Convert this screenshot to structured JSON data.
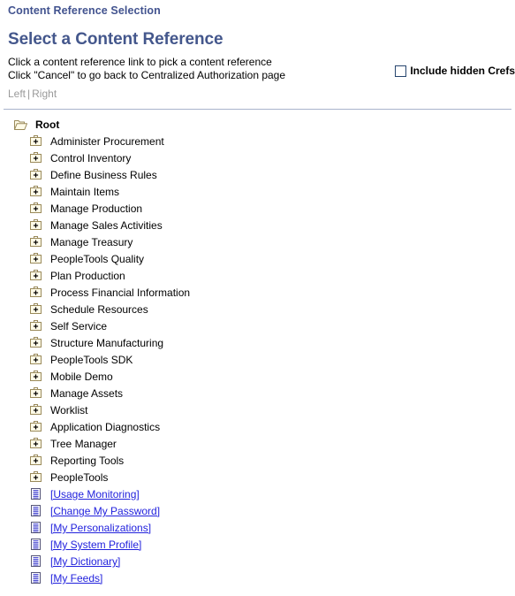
{
  "page": {
    "title": "Content Reference Selection",
    "heading": "Select a Content Reference",
    "instructions": [
      "Click a content reference link to pick a content reference",
      "Click \"Cancel\" to go back to Centralized Authorization page"
    ]
  },
  "view_links": {
    "left_label": "Left",
    "separator": "|",
    "right_label": "Right"
  },
  "options": {
    "include_hidden_crefs_label": "Include hidden Crefs",
    "include_hidden_crefs_checked": false
  },
  "colors": {
    "title_blue": "#42538f",
    "heading_blue": "#44578c",
    "link_blue": "#2222dd",
    "muted_gray": "#9a9a9a",
    "divider": "#a8b4cc",
    "folder_fill": "#fffbe8",
    "folder_border": "#9a8a5a",
    "checkbox_border": "#26456e"
  },
  "tree": {
    "root": {
      "label": "Root",
      "icon": "folder-open-icon",
      "level": 0
    },
    "nodes": [
      {
        "label": "Administer Procurement",
        "icon": "folder-plus-icon",
        "type": "folder",
        "level": 1
      },
      {
        "label": "Control Inventory",
        "icon": "folder-plus-icon",
        "type": "folder",
        "level": 1
      },
      {
        "label": "Define Business Rules",
        "icon": "folder-plus-icon",
        "type": "folder",
        "level": 1
      },
      {
        "label": "Maintain Items",
        "icon": "folder-plus-icon",
        "type": "folder",
        "level": 1
      },
      {
        "label": "Manage Production",
        "icon": "folder-plus-icon",
        "type": "folder",
        "level": 1
      },
      {
        "label": "Manage Sales Activities",
        "icon": "folder-plus-icon",
        "type": "folder",
        "level": 1
      },
      {
        "label": "Manage Treasury",
        "icon": "folder-plus-icon",
        "type": "folder",
        "level": 1
      },
      {
        "label": "PeopleTools Quality",
        "icon": "folder-plus-icon",
        "type": "folder",
        "level": 1
      },
      {
        "label": "Plan Production",
        "icon": "folder-plus-icon",
        "type": "folder",
        "level": 1
      },
      {
        "label": "Process Financial Information",
        "icon": "folder-plus-icon",
        "type": "folder",
        "level": 1
      },
      {
        "label": "Schedule Resources",
        "icon": "folder-plus-icon",
        "type": "folder",
        "level": 1
      },
      {
        "label": "Self Service",
        "icon": "folder-plus-icon",
        "type": "folder",
        "level": 1
      },
      {
        "label": "Structure Manufacturing",
        "icon": "folder-plus-icon",
        "type": "folder",
        "level": 1
      },
      {
        "label": "PeopleTools SDK",
        "icon": "folder-plus-icon",
        "type": "folder",
        "level": 1
      },
      {
        "label": "Mobile Demo",
        "icon": "folder-plus-icon",
        "type": "folder",
        "level": 1
      },
      {
        "label": "Manage Assets",
        "icon": "folder-plus-icon",
        "type": "folder",
        "level": 1
      },
      {
        "label": "Worklist",
        "icon": "folder-plus-icon",
        "type": "folder",
        "level": 1
      },
      {
        "label": "Application Diagnostics",
        "icon": "folder-plus-icon",
        "type": "folder",
        "level": 1
      },
      {
        "label": "Tree Manager",
        "icon": "folder-plus-icon",
        "type": "folder",
        "level": 1
      },
      {
        "label": "Reporting Tools",
        "icon": "folder-plus-icon",
        "type": "folder",
        "level": 1
      },
      {
        "label": "PeopleTools",
        "icon": "folder-plus-icon",
        "type": "folder",
        "level": 1
      },
      {
        "label": "[Usage Monitoring]",
        "icon": "document-icon",
        "type": "link",
        "level": 1
      },
      {
        "label": "[Change My Password]",
        "icon": "document-icon",
        "type": "link",
        "level": 1
      },
      {
        "label": "[My Personalizations]",
        "icon": "document-icon",
        "type": "link",
        "level": 1
      },
      {
        "label": "[My System Profile]",
        "icon": "document-icon",
        "type": "link",
        "level": 1
      },
      {
        "label": "[My Dictionary]",
        "icon": "document-icon",
        "type": "link",
        "level": 1
      },
      {
        "label": "[My Feeds]",
        "icon": "document-icon",
        "type": "link",
        "level": 1
      }
    ]
  }
}
